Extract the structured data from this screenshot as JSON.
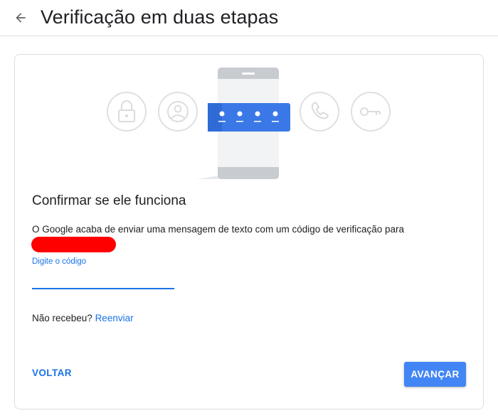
{
  "header": {
    "title": "Verificação em duas etapas",
    "back_icon": "arrow-back-icon"
  },
  "illustration": {
    "icons": [
      "lock-icon",
      "account-icon",
      "phone-icon",
      "key-icon"
    ],
    "code_card_icon": "masked-code-icon"
  },
  "step": {
    "heading": "Confirmar se ele funciona",
    "message": "O Google acaba de enviar uma mensagem de texto com um código de verificação para",
    "code_label": "Digite o código",
    "code_value": "",
    "resend_prompt": "Não recebeu?",
    "resend_link": "Reenviar"
  },
  "actions": {
    "back_label": "VOLTAR",
    "next_label": "AVANÇAR"
  },
  "colors": {
    "accent": "#1a73e8",
    "button": "#4285f4",
    "redaction": "#ff0000"
  }
}
